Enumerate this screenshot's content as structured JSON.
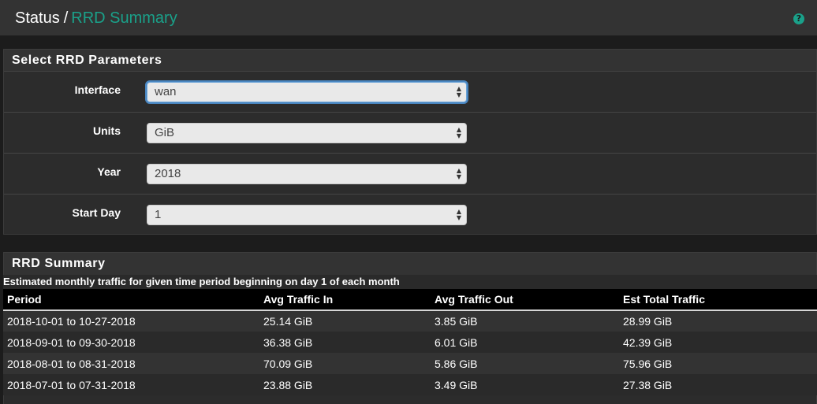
{
  "breadcrumb": {
    "section": "Status",
    "separator": "/",
    "current": "RRD Summary"
  },
  "help_icon": "question-circle-icon",
  "colors": {
    "accent": "#1aa18a",
    "background": "#1c1c1c",
    "panel": "#2c2c2c"
  },
  "params_panel": {
    "title": "Select RRD Parameters",
    "fields": [
      {
        "label": "Interface",
        "value": "wan"
      },
      {
        "label": "Units",
        "value": "GiB"
      },
      {
        "label": "Year",
        "value": "2018"
      },
      {
        "label": "Start Day",
        "value": "1"
      }
    ]
  },
  "summary_panel": {
    "title": "RRD Summary",
    "subtitle": "Estimated monthly traffic for given time period beginning on day 1 of each month",
    "columns": [
      "Period",
      "Avg Traffic In",
      "Avg Traffic Out",
      "Est Total Traffic"
    ],
    "rows": [
      [
        "2018-10-01 to 10-27-2018",
        "25.14 GiB",
        "3.85 GiB",
        "28.99 GiB"
      ],
      [
        "2018-09-01 to 09-30-2018",
        "36.38 GiB",
        "6.01 GiB",
        "42.39 GiB"
      ],
      [
        "2018-08-01 to 08-31-2018",
        "70.09 GiB",
        "5.86 GiB",
        "75.96 GiB"
      ],
      [
        "2018-07-01 to 07-31-2018",
        "23.88 GiB",
        "3.49 GiB",
        "27.38 GiB"
      ]
    ]
  }
}
